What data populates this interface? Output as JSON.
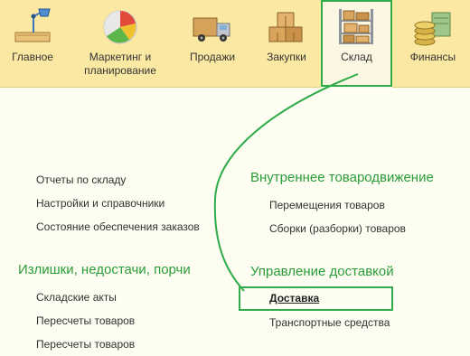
{
  "toolbar": {
    "tabs": [
      {
        "label": "Главное",
        "icon": "desk-lamp-icon"
      },
      {
        "label": "Маркетинг и планирование",
        "icon": "pie-chart-icon"
      },
      {
        "label": "Продажи",
        "icon": "delivery-truck-icon"
      },
      {
        "label": "Закупки",
        "icon": "boxes-icon"
      },
      {
        "label": "Склад",
        "icon": "warehouse-shelves-icon"
      },
      {
        "label": "Финансы",
        "icon": "coins-icon"
      }
    ],
    "active_tab": "Склад"
  },
  "left_column": {
    "links_top": [
      "Отчеты по складу",
      "Настройки и справочники",
      "Состояние обеспечения заказов"
    ],
    "section_title": "Излишки, недостачи, порчи",
    "section_links": [
      "Складские акты",
      "Пересчеты товаров",
      "Пересчеты товаров"
    ]
  },
  "right_column": {
    "section1_title": "Внутреннее товародвижение",
    "section1_links": [
      "Перемещения товаров",
      "Сборки (разборки) товаров"
    ],
    "section2_title": "Управление доставкой",
    "section2_links": [
      "Доставка",
      "Транспортные средства"
    ]
  },
  "colors": {
    "toolbar_bg": "#fbe9a3",
    "page_bg": "#fefdf1",
    "section_title": "#2a9d3a",
    "highlight": "#2eac49"
  }
}
